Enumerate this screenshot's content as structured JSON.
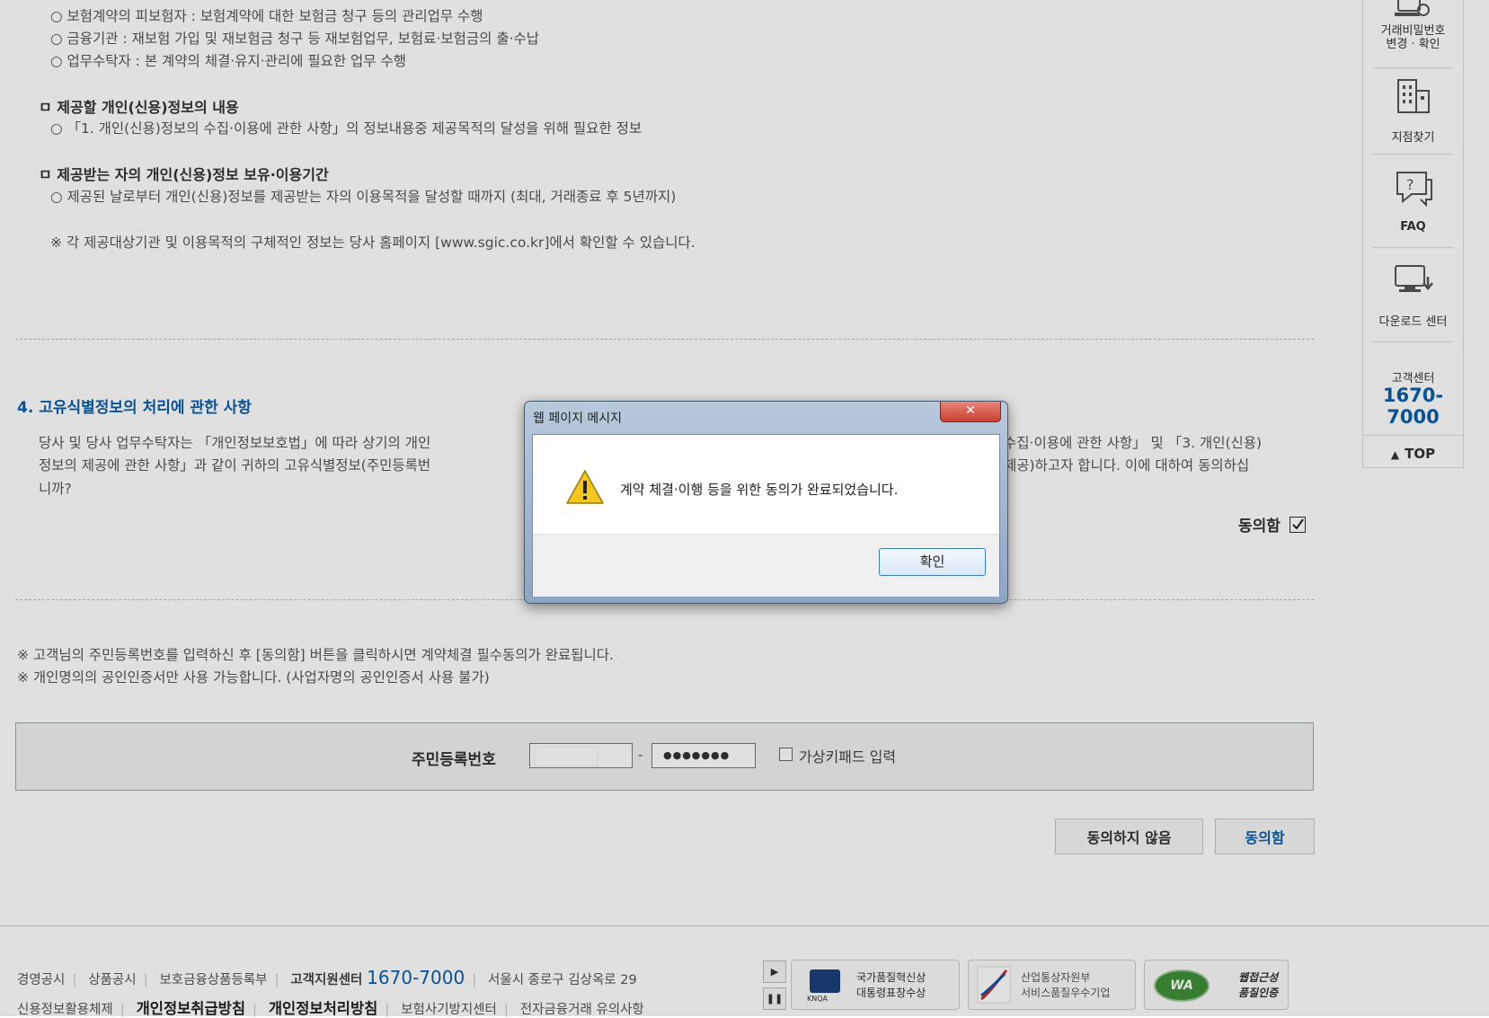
{
  "content": {
    "lines_top": [
      "○ 보험계약의 피보험자 : 보험계약에 대한 보험금 청구 등의 관리업무 수행",
      "○ 금융기관 : 재보험 가입 및 재보험금 청구 등 재보험업무, 보험료·보험금의 출·수납",
      "○ 업무수탁자 : 본 계약의 체결·유지·관리에 필요한 업무 수행"
    ],
    "section_content_title": "ㅁ 제공할 개인(신용)정보의 내용",
    "section_content_line": "○ 「1. 개인(신용)정보의 수집·이용에 관한 사항」의 정보내용중 제공목적의 달성을 위해 필요한 정보",
    "section_period_title": "ㅁ 제공받는 자의 개인(신용)정보 보유·이용기간",
    "section_period_line": "○ 제공된 날로부터 개인(신용)정보를 제공받는 자의 이용목적을 달성할 때까지 (최대, 거래종료 후 5년까지)",
    "notice": "※ 각 제공대상기관 및 이용목적의 구체적인 정보는 당사 홈페이지 [www.sgic.co.kr]에서 확인할 수 있습니다.",
    "section4_title": "4. 고유식별정보의 처리에 관한 사항",
    "section4_p1_left": "당사 및 당사 업무수탁자는 「개인정보보호법」에 따라 상기의 개인",
    "section4_p1_right": "수집·이용에 관한 사항」 및 「3. 개인(신용)",
    "section4_p2_left": "정보의 제공에 관한 사항」과 같이 귀하의 고유식별정보(주민등록번",
    "section4_p2_right": "제공)하고자 합니다. 이에 대하여 동의하십",
    "section4_p3": "니까?",
    "agree_label": "동의함",
    "note1": "※ 고객님의 주민등록번호를 입력하신 후 [동의함] 버튼을 클릭하시면 계약체결 필수동의가 완료됩니다.",
    "note2": "※ 개인명의의 공인인증서만 사용 가능합니다. (사업자명의 공인인증서 사용 불가)"
  },
  "id_form": {
    "label": "주민등록번호",
    "front_value": "",
    "separator": "-",
    "back_value": "●●●●●●●",
    "virtual_keypad_label": "가상키패드 입력"
  },
  "buttons": {
    "disagree": "동의하지 않음",
    "agree": "동의함"
  },
  "quick_menu": {
    "password_label_1": "거래비밀번호",
    "password_label_2": "변경 · 확인",
    "branch": "지점찾기",
    "faq": "FAQ",
    "download": "다운로드 센터",
    "cs_label": "고객센터",
    "cs_phone": "1670-7000",
    "top": "TOP"
  },
  "footer": {
    "row1": [
      "경영공시",
      "상품공시",
      "보호금융상품등록부"
    ],
    "cs_label": "고객지원센터",
    "cs_phone": "1670-7000",
    "address": "서울시 종로구 김상옥로 29",
    "row2": [
      "신용정보활용체제",
      "개인정보취급방침",
      "개인정보처리방침",
      "보험사기방지센터",
      "전자금융거래 유의사항"
    ],
    "badge1": [
      "국가품질혁신상",
      "대통령표창수상"
    ],
    "badge1_logo": "KNQA",
    "badge2": [
      "산업통상자원부",
      "서비스품질우수기업"
    ],
    "badge3": [
      "웹접근성",
      "품질인증"
    ],
    "badge3_logo": "WA"
  },
  "dialog": {
    "title": "웹 페이지 메시지",
    "message": "계약 체결·이행 등을 위한 동의가 완료되었습니다.",
    "ok": "확인"
  },
  "colors": {
    "accent_blue": "#0b5ea8",
    "close_red": "#c9402f"
  }
}
